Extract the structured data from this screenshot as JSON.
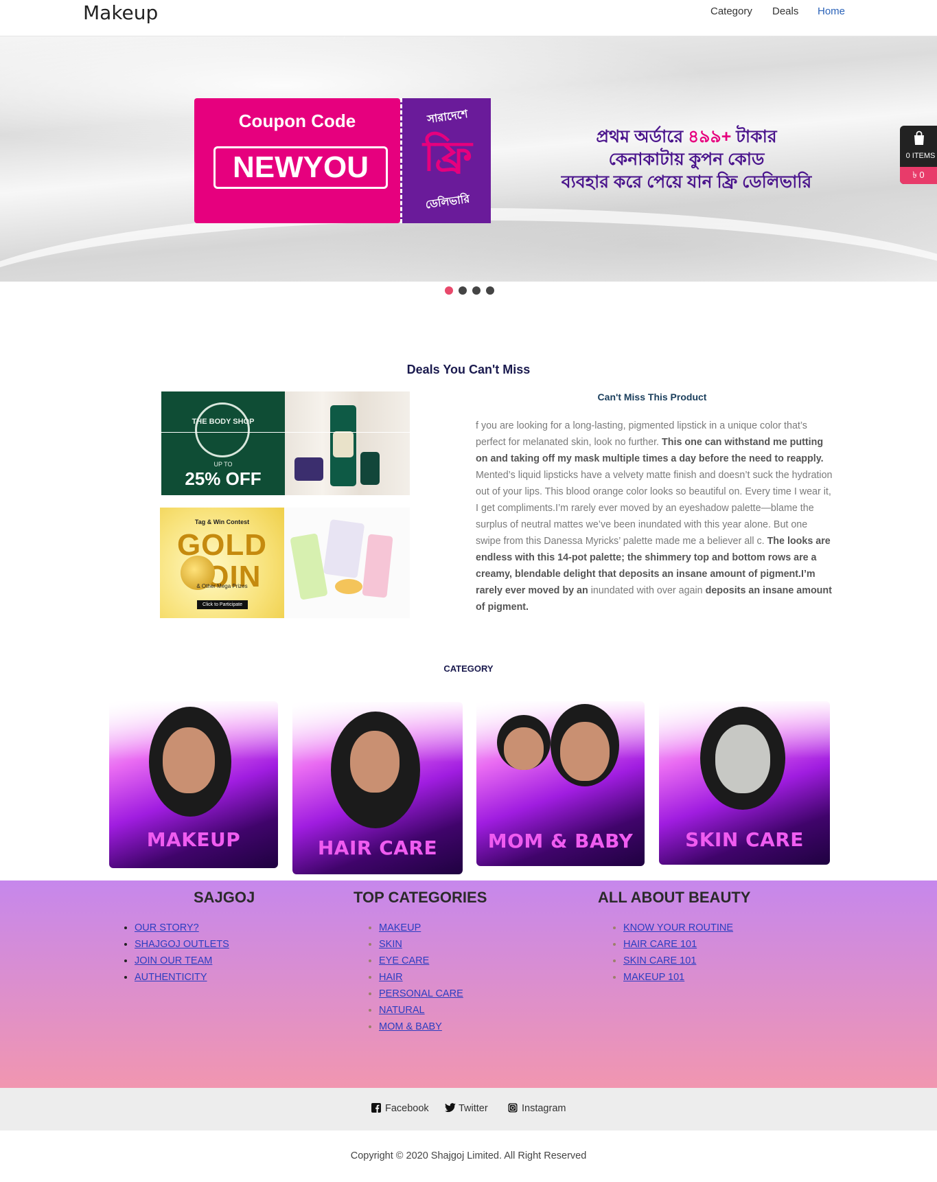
{
  "nav": {
    "brand": "Makeup",
    "links": [
      "Category",
      "Deals",
      "Home"
    ]
  },
  "hero": {
    "coupon_title": "Coupon Code",
    "coupon_code": "NEWYOU",
    "ticket_top": "সারাদেশে",
    "ticket_big": "ফ্রি",
    "ticket_bottom": "ডেলিভারি",
    "line1_a": "প্রথম অর্ডারে ",
    "line1_b": "৪৯৯+",
    "line1_c": " টাকার",
    "line2": "কেনাকাটায় কুপন কোড",
    "line3": "ব্যবহার করে পেয়ে যান ফ্রি ডেলিভারি"
  },
  "cart": {
    "items": "0 ITEMS",
    "price": "৳ 0"
  },
  "carousel": {
    "active_index": 0,
    "count": 4
  },
  "deals": {
    "title": "Deals You Can't Miss",
    "bodyshop_text": "THE BODY SHOP",
    "bodyshop_upto": "UP TO",
    "bodyshop_off": "25% OFF",
    "gold_tag": "Tag & Win Contest",
    "gold_big": "GOLD COIN",
    "gold_sub": "& Other Mega Prizes",
    "gold_btn": "Click to Participate",
    "product_title": "Can't Miss This Product",
    "desc": [
      {
        "t": "f you are looking for a long-lasting, pigmented lipstick in a unique color that’s perfect for melanated skin, look no further. ",
        "b": false
      },
      {
        "t": "This one can withstand me putting on and taking off my mask multiple times a day before the need to reapply.",
        "b": true
      },
      {
        "t": " Mented’s liquid lipsticks have a velvety matte finish and doesn’t suck the hydration out of your lips. This blood orange color looks so beautiful on. Every time I wear it, I get compliments.I’m rarely ever moved by an eyeshadow palette—blame the surplus of neutral mattes we’ve been inundated with this year alone. But one swipe from this Danessa Myricks’ palette made me a believer all c. ",
        "b": false
      },
      {
        "t": "The looks are endless with this 14-pot palette; the shimmery top and bottom rows are a creamy, blendable delight that deposits an insane amount of pigment.I’m rarely ever moved by an",
        "b": true
      },
      {
        "t": " inundated with over again ",
        "b": false
      },
      {
        "t": "deposits an insane amount of pigment.",
        "b": true
      }
    ]
  },
  "category": {
    "title": "CATEGORY",
    "cards": [
      "MAKEUP",
      "HAIR CARE",
      "MOM & BABY",
      "SKIN CARE"
    ]
  },
  "footer": {
    "col1": {
      "title": "SAJGOJ",
      "links": [
        "OUR STORY?",
        "SHAJGOJ OUTLETS",
        "JOIN OUR TEAM",
        "AUTHENTICITY"
      ]
    },
    "col2": {
      "title": "TOP CATEGORIES",
      "links": [
        "MAKEUP",
        "SKIN",
        "EYE CARE",
        "HAIR",
        "PERSONAL CARE",
        "NATURAL",
        "MOM & BABY"
      ]
    },
    "col3": {
      "title": "ALL ABOUT BEAUTY",
      "links": [
        "KNOW YOUR ROUTINE",
        "HAIR CARE 101",
        "SKIN CARE 101",
        "MAKEUP 101"
      ]
    }
  },
  "social": [
    "Facebook",
    "Twitter",
    "Instagram"
  ],
  "copyright": "Copyright © 2020 Shajgoj Limited. All Right Reserved",
  "colors": {
    "accent": "#e6007e",
    "purple": "#4a148c",
    "nav_active": "#2a62b8",
    "cart_price_bg": "#e83b6a"
  }
}
